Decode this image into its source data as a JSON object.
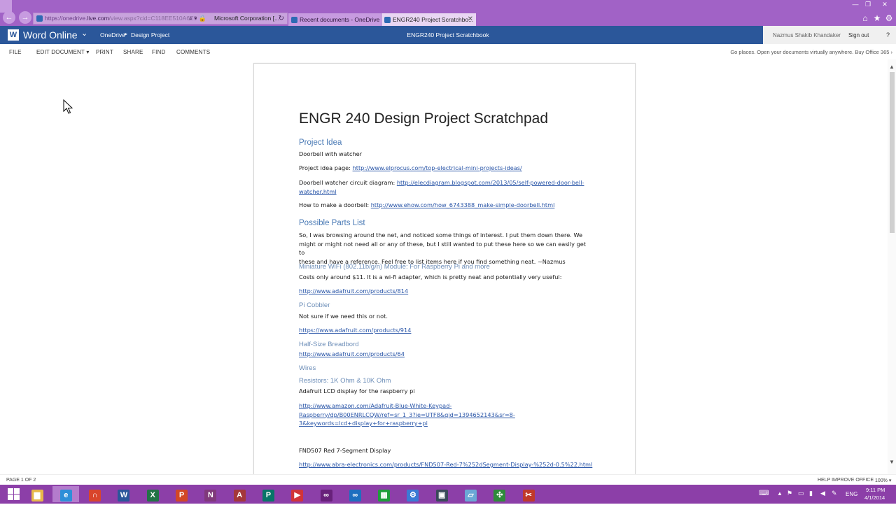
{
  "browser": {
    "back_icon": "back-arrow-icon",
    "forward_icon": "forward-arrow-icon",
    "address": {
      "url_lead": "https://onedrive.",
      "url_host": "live.com",
      "url_rest": "/view.aspx?cid=C118EE510A6E9",
      "search_glyph": "⌕",
      "dropdown_glyph": "▾",
      "lock_glyph": "🔒",
      "security_text": "Microsoft Corporation [...",
      "reload_glyph": "↻"
    },
    "tabs": [
      {
        "label": "Recent documents - OneDrive"
      },
      {
        "label": "ENGR240 Project Scratchbo...",
        "close": "✕"
      }
    ],
    "window_controls": {
      "minimize": "—",
      "maximize": "❐",
      "close": "✕"
    },
    "toolbar_icons": {
      "home": "⌂",
      "favorites": "★",
      "settings": "⚙"
    }
  },
  "header": {
    "logo_letter": "W",
    "app_name": "Word Online",
    "app_chevron": "⌄",
    "breadcrumb": {
      "root": "OneDrive",
      "sep": "▸",
      "folder": "Design Project"
    },
    "document_title": "ENGR240 Project Scratchbook",
    "user_name": "Nazmus Shakib Khandaker",
    "sign_out": "Sign out",
    "help": "?"
  },
  "ribbon": {
    "file": "FILE",
    "edit_document": "EDIT DOCUMENT ▾",
    "print": "PRINT",
    "share": "SHARE",
    "find": "FIND",
    "comments": "COMMENTS",
    "promo": "Go places. Open your documents virtually anywhere. Buy Office 365 ›"
  },
  "document": {
    "title": "ENGR 240 Design  Project Scratchpad",
    "project_idea_heading": "Project Idea",
    "project_idea_text": "Doorbell with watcher",
    "idea_page_label": "Project idea page: ",
    "idea_page_link": "http://www.elprocus.com/top-electrical-mini-projects-ideas/",
    "circuit_label": "Doorbell watcher circuit diagram: ",
    "circuit_link_1": "http://elecdiagram.blogspot.com/2013/05/self-powered-door-bell-",
    "circuit_link_2": "watcher.html",
    "howto_label": "How to make a doorbell: ",
    "howto_link": "http://www.ehow.com/how_6743388_make-simple-doorbell.html",
    "parts_heading": "Possible Parts List",
    "parts_intro_1": "So, I was browsing around the net, and noticed some things of interest. I put them down there. We",
    "parts_intro_2": "might or might not need all or any of these, but I still wanted to put these here so we can  easily get to",
    "parts_intro_3": "these and have a reference. Feel free to list items here if you find something neat. ~Nazmus",
    "wifi_heading": "Miniature WiFi (802.11b/g/n) Module: For Raspberry Pi and more",
    "wifi_text": "Costs only around $11.  It is a wi-fi adapter, which is pretty neat and potentially very useful:",
    "wifi_link": "http://www.adafruit.com/products/814",
    "cobbler_heading": "Pi Cobbler",
    "cobbler_text": "Not sure if we need this or not.",
    "cobbler_link": "https://www.adafruit.com/products/914",
    "breadboard_heading": "Half-Size Breadbord",
    "breadboard_link": "http://www.adafruit.com/products/64",
    "wires_heading": "Wires",
    "resistors_heading": "Resistors: 1K Ohm & 10K Ohm",
    "lcd_text": "Adafruit LCD display for the raspberry pi",
    "lcd_link_1": "http://www.amazon.com/Adafruit-Blue-White-Keypad-",
    "lcd_link_2": "Raspberry/dp/B00ENRLCQW/ref=sr_1_3?ie=UTF8&qid=1394652143&sr=8-",
    "lcd_link_3": "3&keywords=lcd+display+for+raspberry+pi",
    "segment_text": "FND507 Red 7-Segment Display",
    "segment_link": "http://www.abra-electronics.com/products/FND507-Red-7%252dSegment-Display-%252d-0.5%22.html"
  },
  "status": {
    "page_count": "PAGE 1 OF 2",
    "help_improve": "HELP IMPROVE OFFICE",
    "zoom": "100%",
    "zoom_caret": "▾"
  },
  "taskbar": {
    "items": [
      {
        "name": "file-explorer-icon",
        "glyph": "▆",
        "color": "#e8b84a"
      },
      {
        "name": "internet-explorer-icon",
        "glyph": "e",
        "color": "#2d8fd8"
      },
      {
        "name": "headphones-icon",
        "glyph": "∩",
        "color": "#d9452b"
      },
      {
        "name": "word-icon",
        "glyph": "W",
        "color": "#2b579a"
      },
      {
        "name": "excel-icon",
        "glyph": "X",
        "color": "#217346"
      },
      {
        "name": "powerpoint-icon",
        "glyph": "P",
        "color": "#d24726"
      },
      {
        "name": "onenote-icon",
        "glyph": "N",
        "color": "#80397b"
      },
      {
        "name": "access-icon",
        "glyph": "A",
        "color": "#a4373a"
      },
      {
        "name": "publisher-icon",
        "glyph": "P",
        "color": "#077568"
      },
      {
        "name": "media-player-icon",
        "glyph": "▶",
        "color": "#d13438"
      },
      {
        "name": "visual-studio-icon",
        "glyph": "∞",
        "color": "#68217a"
      },
      {
        "name": "visual-studio-blue-icon",
        "glyph": "∞",
        "color": "#1e6fbf"
      },
      {
        "name": "spreadsheet-app-icon",
        "glyph": "▦",
        "color": "#1e9e3a"
      },
      {
        "name": "settings-app-icon",
        "glyph": "⚙",
        "color": "#3a7bd5"
      },
      {
        "name": "photo-app-icon",
        "glyph": "▣",
        "color": "#3a4a5a"
      },
      {
        "name": "notepad-icon",
        "glyph": "▱",
        "color": "#6ba7d6"
      },
      {
        "name": "network-app-icon",
        "glyph": "✣",
        "color": "#2e8b3a"
      },
      {
        "name": "snipping-tool-icon",
        "glyph": "✂",
        "color": "#c0392b"
      }
    ],
    "tray": {
      "keyboard": "⌨",
      "up": "▲",
      "lang": "ENG",
      "time": "9:11 PM",
      "date": "4/1/2014"
    }
  }
}
